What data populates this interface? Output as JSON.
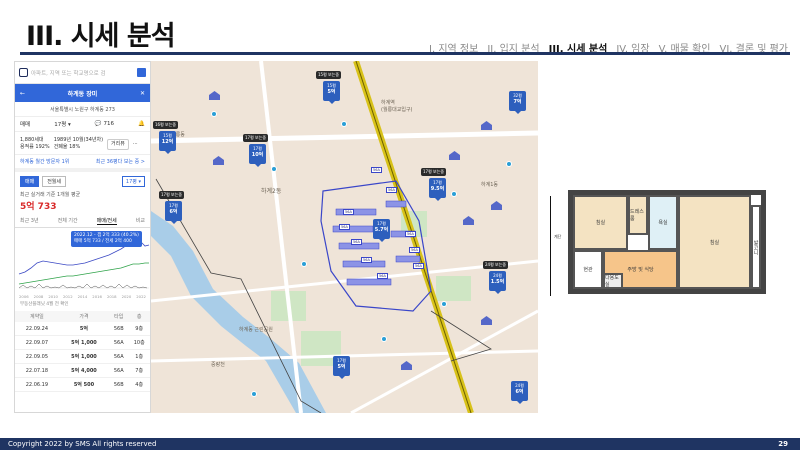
{
  "slide": {
    "title": "III. 시세 분석",
    "nav": [
      {
        "label": "I. 지역 정보",
        "active": false
      },
      {
        "label": "II. 입지 분석",
        "active": false
      },
      {
        "label": "III. 시세 분석",
        "active": true
      },
      {
        "label": "IV. 임장",
        "active": false
      },
      {
        "label": "V. 매물 확인",
        "active": false
      },
      {
        "label": "VI. 결론 및 평가",
        "active": false
      }
    ],
    "footer_text": "Copyright 2022 by SMS All rights reserved",
    "page_number": "29"
  },
  "panel": {
    "search_placeholder": "아파트, 지역 또는 학교명으로 검",
    "complex_name": "하계동 장미",
    "address": "서울특별시 노원구 하계동 273",
    "tabs": {
      "trade": "매매",
      "size": "17평",
      "talk_count": "716"
    },
    "stats": {
      "households": "1,880세대",
      "far": "용적률 192%",
      "built": "1989년 10월(34년차)",
      "bcr": "건폐율 18%",
      "distance_btn": "거리뷰"
    },
    "notice": "하계동 월간 방문자 1위",
    "notice_right": "최근 36평다 보는 중 >",
    "trade_chip": "매매",
    "rent_chip": "전월세",
    "size_select": "17평",
    "recent_label": "최근 실거래 기준 1개월 평균",
    "price": "5억 733",
    "subtabs": [
      "최근 3년",
      "전체 기간",
      "매매/전세",
      "비교"
    ],
    "tooltip_line1": "2022.12 - 갭 2억 333 (40.2%)",
    "tooltip_line2": "매매 5억 733 / 전세 2억 400",
    "x_axis": [
      "2006",
      "2008",
      "2010",
      "2012",
      "2014",
      "2016",
      "2018",
      "2020",
      "2022"
    ],
    "chart_caption": "부동산플래닛 4월 전 확인",
    "table_headers": [
      "계약일",
      "가격",
      "타입",
      "층"
    ],
    "rows": [
      {
        "date": "22.09.24",
        "price": "5억",
        "type": "56B",
        "floor": "9층"
      },
      {
        "date": "22.09.07",
        "price": "5억 1,000",
        "type": "56A",
        "floor": "10층"
      },
      {
        "date": "22.09.05",
        "price": "5억 1,000",
        "type": "56A",
        "floor": "1층"
      },
      {
        "date": "22.07.18",
        "price": "5억 4,000",
        "type": "56A",
        "floor": "7층"
      },
      {
        "date": "22.06.19",
        "price": "5억 500",
        "type": "56B",
        "floor": "4층"
      }
    ]
  },
  "map": {
    "station": "하계역",
    "station_sub": "(월릉대교입구)",
    "dong": "하계2동",
    "park": "하계동 근린공원",
    "labels": [
      "공릉동",
      "중랑천",
      "하계1동"
    ],
    "markers": [
      {
        "tag": "15평 보는중",
        "val": "5억",
        "sub": "15평"
      },
      {
        "tag": "16평 보는중",
        "val": "12억",
        "sub": "15평"
      },
      {
        "tag": "17평 보는중",
        "val": "10억",
        "sub": "17평"
      },
      {
        "tag": "17평 보는중",
        "val": "9.5억",
        "sub": "17평"
      },
      {
        "tag": "17평 보는중",
        "val": "6억",
        "sub": "17평"
      },
      {
        "tag": "24평 보는중",
        "val": "1.5억",
        "sub": "24평"
      },
      {
        "tag": "",
        "val": "7억",
        "sub": "32평"
      },
      {
        "tag": "",
        "val": "5.7억",
        "sub": "17평"
      },
      {
        "tag": "",
        "val": "5억",
        "sub": "17평"
      },
      {
        "tag": "",
        "val": "6억",
        "sub": "24평"
      }
    ],
    "buildings": [
      "56A",
      "56A",
      "56A",
      "56A",
      "56A",
      "56A",
      "56A",
      "56A",
      "56A",
      "56A"
    ]
  },
  "plan": {
    "rooms": [
      "침실",
      "드레스룸",
      "침실",
      "주방 및 식당",
      "다용도실",
      "욕실"
    ],
    "side": "발코니",
    "entrance": "현관",
    "left_label": "계단"
  }
}
